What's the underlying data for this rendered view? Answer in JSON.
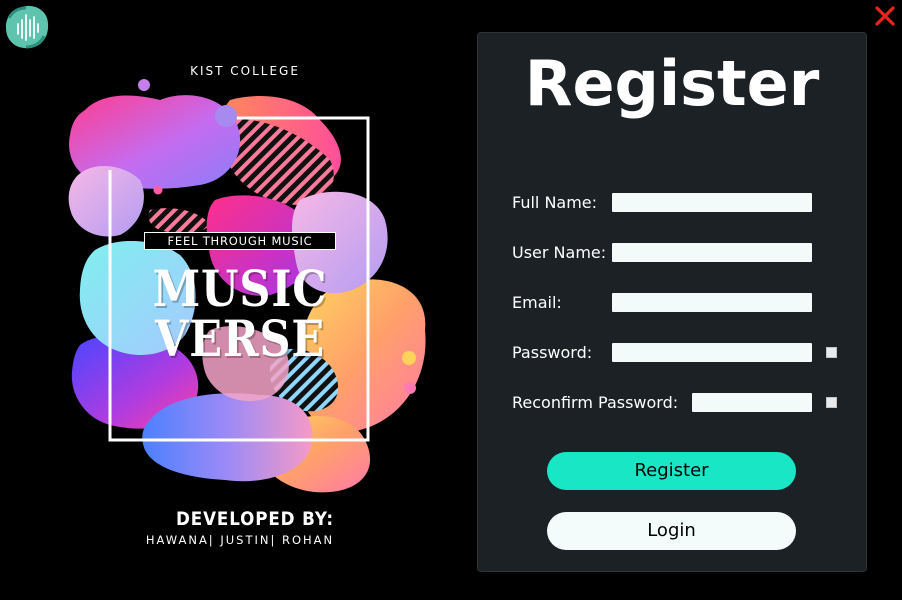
{
  "window": {
    "close_icon": "close-icon",
    "app_icon": "music-wave-logo-icon",
    "close_color": "#e8261c"
  },
  "poster": {
    "college": "KIST COLLEGE",
    "tagline": "FEEL THROUGH MUSIC",
    "brand_line_1": "MUSIC",
    "brand_line_2": "VERSE",
    "developed_by": "DEVELOPED BY:",
    "developers": "HAWANA| JUSTIN| ROHAN"
  },
  "form": {
    "title": "Register",
    "fields": [
      {
        "label": "Full Name:",
        "value": ""
      },
      {
        "label": "User Name:",
        "value": ""
      },
      {
        "label": "Email:",
        "value": ""
      },
      {
        "label": "Password:",
        "value": ""
      },
      {
        "label": "Reconfirm Password:",
        "value": ""
      }
    ],
    "register_label": "Register",
    "login_label": "Login"
  },
  "colors": {
    "background": "#000000",
    "panel": "#1b2124",
    "accent": "#19e6c5",
    "input_bg": "#f2fbfa"
  }
}
